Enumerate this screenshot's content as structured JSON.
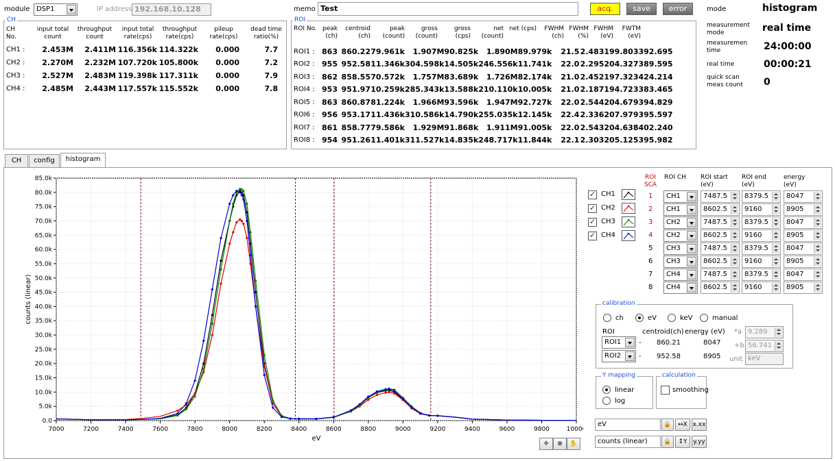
{
  "header": {
    "module_label": "module",
    "module_value": "DSP1",
    "ip_label": "IP address",
    "ip_value": "192.168.10.128",
    "memo_label": "memo",
    "memo_value": "Test",
    "buttons": {
      "acq": "acq.",
      "save": "save",
      "error": "error"
    },
    "status": [
      {
        "label": "mode",
        "value": "histogram"
      },
      {
        "label": "measurement mode",
        "value": "real time"
      },
      {
        "label": "measuremen time",
        "value": "24:00:00"
      },
      {
        "label": "real time",
        "value": "00:00:21"
      },
      {
        "label": "quick scan meas count",
        "value": "0"
      }
    ]
  },
  "ch_panel": {
    "title": "CH",
    "headers": [
      "CH No.",
      "input total count",
      "throughput count",
      "input total rate(cps)",
      "throughput rate(cps)",
      "pileup rate(cps)",
      "dead time ratio(%)"
    ],
    "rows": [
      {
        "ch": "CH1",
        "sep": ":",
        "input_total": "2.453M",
        "throughput": "2.411M",
        "input_rate": "116.356k",
        "through_rate": "114.322k",
        "pileup": "0.000",
        "dead": "7.7"
      },
      {
        "ch": "CH2",
        "sep": ":",
        "input_total": "2.270M",
        "throughput": "2.232M",
        "input_rate": "107.720k",
        "through_rate": "105.800k",
        "pileup": "0.000",
        "dead": "7.2"
      },
      {
        "ch": "CH3",
        "sep": ":",
        "input_total": "2.527M",
        "throughput": "2.483M",
        "input_rate": "119.398k",
        "through_rate": "117.311k",
        "pileup": "0.000",
        "dead": "7.9"
      },
      {
        "ch": "CH4",
        "sep": ":",
        "input_total": "2.485M",
        "throughput": "2.443M",
        "input_rate": "117.557k",
        "through_rate": "115.552k",
        "pileup": "0.000",
        "dead": "7.8"
      }
    ]
  },
  "roi_panel": {
    "title": "ROI",
    "headers": [
      "ROI No.",
      "peak (ch)",
      "centroid (ch)",
      "peak (count)",
      "gross (count)",
      "gross (cps)",
      "net (count)",
      "net (cps)",
      "FWHM (ch)",
      "FWHM (%)",
      "FWHM (eV)",
      "FWTM (eV)"
    ],
    "rows": [
      [
        "ROI1 :",
        "863",
        "860.22",
        "79.961k",
        "1.907M",
        "90.825k",
        "1.890M",
        "89.979k",
        "21.5",
        "2.483",
        "199.803",
        "392.695"
      ],
      [
        "ROI2 :",
        "955",
        "952.58",
        "11.346k",
        "304.598k",
        "14.505k",
        "246.556k",
        "11.741k",
        "22.0",
        "2.295",
        "204.327",
        "389.595"
      ],
      [
        "ROI3 :",
        "862",
        "858.55",
        "70.572k",
        "1.757M",
        "83.689k",
        "1.726M",
        "82.174k",
        "21.0",
        "2.452",
        "197.323",
        "424.214"
      ],
      [
        "ROI4 :",
        "953",
        "951.97",
        "10.259k",
        "285.343k",
        "13.588k",
        "210.110k",
        "10.005k",
        "21.0",
        "2.187",
        "194.723",
        "383.465"
      ],
      [
        "ROI5 :",
        "863",
        "860.87",
        "81.224k",
        "1.966M",
        "93.596k",
        "1.947M",
        "92.727k",
        "22.0",
        "2.544",
        "204.679",
        "394.829"
      ],
      [
        "ROI6 :",
        "956",
        "953.17",
        "11.436k",
        "310.586k",
        "14.790k",
        "255.035k",
        "12.145k",
        "22.4",
        "2.336",
        "207.979",
        "395.597"
      ],
      [
        "ROI7 :",
        "861",
        "858.77",
        "79.586k",
        "1.929M",
        "91.868k",
        "1.911M",
        "91.005k",
        "22.0",
        "2.543",
        "204.638",
        "402.240"
      ],
      [
        "ROI8 :",
        "954",
        "951.26",
        "11.401k",
        "311.527k",
        "14.835k",
        "248.717k",
        "11.844k",
        "22.1",
        "2.303",
        "205.125",
        "395.982"
      ]
    ]
  },
  "tabs": [
    {
      "label": "CH",
      "active": false
    },
    {
      "label": "config",
      "active": false
    },
    {
      "label": "histogram",
      "active": true
    }
  ],
  "legend": [
    {
      "label": "CH1",
      "color": "#000000"
    },
    {
      "label": "CH2",
      "color": "#e00000"
    },
    {
      "label": "CH3",
      "color": "#008000"
    },
    {
      "label": "CH4",
      "color": "#0000e0"
    }
  ],
  "roi_sca": {
    "headers": [
      "ROI SCA",
      "ROI CH",
      "ROI start (eV)",
      "ROI end (eV)",
      "energy (eV)"
    ],
    "rows": [
      {
        "no": "1",
        "ch": "CH1",
        "start": "7487.5",
        "end": "8379.5",
        "energy": "8047",
        "red": true
      },
      {
        "no": "2",
        "ch": "CH1",
        "start": "8602.5",
        "end": "9160",
        "energy": "8905",
        "red": true
      },
      {
        "no": "3",
        "ch": "CH2",
        "start": "7487.5",
        "end": "8379.5",
        "energy": "8047",
        "red": true
      },
      {
        "no": "4",
        "ch": "CH2",
        "start": "8602.5",
        "end": "9160",
        "energy": "8905",
        "red": true
      },
      {
        "no": "5",
        "ch": "CH3",
        "start": "7487.5",
        "end": "8379.5",
        "energy": "8047",
        "red": false
      },
      {
        "no": "6",
        "ch": "CH3",
        "start": "8602.5",
        "end": "9160",
        "energy": "8905",
        "red": false
      },
      {
        "no": "7",
        "ch": "CH4",
        "start": "7487.5",
        "end": "8379.5",
        "energy": "8047",
        "red": false
      },
      {
        "no": "8",
        "ch": "CH4",
        "start": "8602.5",
        "end": "9160",
        "energy": "8905",
        "red": false
      }
    ]
  },
  "calibration": {
    "title": "calibration",
    "options": [
      "ch",
      "eV",
      "keV",
      "manual"
    ],
    "selected": "eV",
    "col_roi": "ROI",
    "col_centroid": "centroid(ch)",
    "col_energy": "energy (eV)",
    "rows": [
      {
        "roi": "ROI1",
        "centroid": "860.21",
        "energy": "8047"
      },
      {
        "roi": "ROI2",
        "centroid": "952.58",
        "energy": "8905"
      }
    ],
    "a_label": "*a",
    "a_value": "9.289",
    "b_label": "+b",
    "b_value": "56.741",
    "unit_label": "unit",
    "unit_value": "keV"
  },
  "y_mapping": {
    "title": "Y mapping",
    "options": [
      "linear",
      "log"
    ],
    "selected": "linear"
  },
  "calculation": {
    "title": "calculation",
    "smoothing_label": "smoothing",
    "smoothing": false
  },
  "axis_fields": {
    "x": "eV",
    "y": "counts (linear)"
  },
  "chart_data": {
    "type": "line",
    "xlabel": "eV",
    "ylabel": "counts (linear)",
    "xlim": [
      7000,
      10000
    ],
    "ylim": [
      0,
      85000
    ],
    "xticks": [
      "7000",
      "7200",
      "7400",
      "7600",
      "7800",
      "8000",
      "8200",
      "8400",
      "8600",
      "8800",
      "9000",
      "9200",
      "9400",
      "9600",
      "9800",
      "10000"
    ],
    "yticks": [
      "0.0",
      "5.0k",
      "10.0k",
      "15.0k",
      "20.0k",
      "25.0k",
      "30.0k",
      "35.0k",
      "40.0k",
      "45.0k",
      "50.0k",
      "55.0k",
      "60.0k",
      "65.0k",
      "70.0k",
      "75.0k",
      "80.0k",
      "85.0k"
    ],
    "roi_markers": [
      {
        "x": 7487.5,
        "style": "dashed",
        "color": "#7a1010"
      },
      {
        "x": 8379.5,
        "style": "dashed",
        "color": "#333333"
      },
      {
        "x": 8602.5,
        "style": "dashed",
        "color": "#7a1010"
      },
      {
        "x": 9160,
        "style": "dashed",
        "color": "#7a1010"
      }
    ],
    "grid": true,
    "series": [
      {
        "name": "CH1",
        "color": "#000000",
        "x": [
          7000,
          7200,
          7400,
          7500,
          7600,
          7700,
          7750,
          7800,
          7850,
          7900,
          7950,
          8000,
          8020,
          8040,
          8060,
          8070,
          8080,
          8100,
          8120,
          8150,
          8200,
          8250,
          8300,
          8350,
          8400,
          8500,
          8600,
          8700,
          8750,
          8800,
          8850,
          8900,
          8920,
          8950,
          9000,
          9050,
          9100,
          9150,
          9200,
          9300,
          9400,
          9600,
          9800,
          10000
        ],
        "y": [
          600,
          300,
          300,
          400,
          700,
          2000,
          4500,
          9500,
          20000,
          37000,
          56000,
          70000,
          75000,
          79000,
          80500,
          80000,
          79000,
          73000,
          62000,
          45000,
          20000,
          6000,
          1600,
          700,
          600,
          600,
          1200,
          3500,
          5500,
          8000,
          9800,
          10500,
          10700,
          10000,
          7500,
          4500,
          2500,
          1800,
          1700,
          1200,
          500,
          200,
          100,
          50
        ]
      },
      {
        "name": "CH2",
        "color": "#e00000",
        "x": [
          7000,
          7200,
          7400,
          7500,
          7600,
          7700,
          7750,
          7800,
          7850,
          7900,
          7950,
          8000,
          8020,
          8040,
          8060,
          8070,
          8080,
          8100,
          8120,
          8150,
          8200,
          8250,
          8300,
          8350,
          8400,
          8500,
          8600,
          8700,
          8750,
          8800,
          8850,
          8900,
          8920,
          8950,
          9000,
          9050,
          9100,
          9150,
          9200,
          9300,
          9400,
          9600,
          9800,
          10000
        ],
        "y": [
          600,
          300,
          350,
          800,
          1500,
          3500,
          5500,
          9500,
          17000,
          30000,
          48000,
          62000,
          66000,
          69500,
          70500,
          70000,
          69000,
          64000,
          55000,
          40000,
          19000,
          6000,
          1600,
          700,
          600,
          600,
          1200,
          3200,
          5000,
          7300,
          9000,
          9800,
          10000,
          9500,
          7200,
          4300,
          2400,
          1800,
          1700,
          1200,
          500,
          200,
          100,
          50
        ]
      },
      {
        "name": "CH3",
        "color": "#008000",
        "x": [
          7000,
          7200,
          7400,
          7500,
          7600,
          7700,
          7750,
          7800,
          7850,
          7900,
          7950,
          8000,
          8020,
          8040,
          8060,
          8070,
          8080,
          8100,
          8120,
          8150,
          8200,
          8250,
          8300,
          8350,
          8400,
          8500,
          8600,
          8700,
          8750,
          8800,
          8850,
          8900,
          8920,
          8950,
          9000,
          9050,
          9100,
          9150,
          9200,
          9300,
          9400,
          9600,
          9800,
          10000
        ],
        "y": [
          600,
          300,
          300,
          400,
          600,
          1800,
          4000,
          8500,
          18000,
          34000,
          53000,
          70000,
          76000,
          80000,
          81200,
          81000,
          80500,
          76000,
          66000,
          49000,
          23000,
          7000,
          1700,
          700,
          600,
          600,
          1100,
          3300,
          5300,
          8000,
          10000,
          10800,
          11200,
          10800,
          8000,
          5000,
          2700,
          1800,
          1700,
          1200,
          500,
          200,
          100,
          50
        ]
      },
      {
        "name": "CH4",
        "color": "#0000e0",
        "x": [
          7000,
          7200,
          7400,
          7500,
          7600,
          7700,
          7750,
          7800,
          7850,
          7900,
          7950,
          8000,
          8020,
          8040,
          8060,
          8070,
          8080,
          8100,
          8120,
          8150,
          8200,
          8250,
          8300,
          8350,
          8400,
          8500,
          8600,
          8700,
          8750,
          8800,
          8850,
          8900,
          8920,
          8950,
          9000,
          9050,
          9100,
          9150,
          9200,
          9300,
          9400,
          9600,
          9800,
          10000
        ],
        "y": [
          600,
          300,
          300,
          400,
          800,
          2500,
          6000,
          14000,
          28000,
          46000,
          64000,
          76000,
          79000,
          80500,
          80000,
          79000,
          77500,
          70000,
          58000,
          40000,
          16000,
          4500,
          1300,
          700,
          600,
          600,
          1200,
          3600,
          5700,
          8400,
          10200,
          11000,
          11100,
          10500,
          7600,
          4600,
          2500,
          1800,
          1700,
          1200,
          500,
          200,
          100,
          50
        ]
      }
    ]
  }
}
